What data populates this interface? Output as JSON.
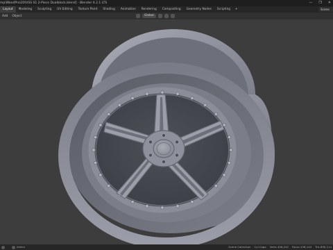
{
  "window": {
    "title": "mp\\WandPro\\20\\VSS S1 2-Piece Dualblock.blend] - Blender 4.2.1 LTS",
    "controls": [
      "—",
      "❐",
      "✕"
    ]
  },
  "workspace_tabs": [
    {
      "label": "Layout",
      "active": true
    },
    {
      "label": "Modeling",
      "active": false
    },
    {
      "label": "Sculpting",
      "active": false
    },
    {
      "label": "UV Editing",
      "active": false
    },
    {
      "label": "Texture Paint",
      "active": false
    },
    {
      "label": "Shading",
      "active": false
    },
    {
      "label": "Animation",
      "active": false
    },
    {
      "label": "Rendering",
      "active": false
    },
    {
      "label": "Compositing",
      "active": false
    },
    {
      "label": "Geometry Nodes",
      "active": false
    },
    {
      "label": "Scripting",
      "active": false
    }
  ],
  "tab_add_label": "+",
  "toolbar": {
    "transform_orientation": "Global",
    "scene_label": "Scene"
  },
  "header": {
    "items": [
      "Add",
      "Object"
    ]
  },
  "statusbar": {
    "left_items": [
      "",
      "Select"
    ],
    "right_items": [
      "Scene Collection",
      "Cyl.Cage",
      "Verts 456,242",
      "Faces 436,144",
      "Tris 890,114"
    ]
  },
  "viewport": {
    "background": "#3d3d3d",
    "wheel_color": "#8a8c98",
    "bolt_count": 6,
    "rivet_count": 28,
    "spoke_count": 5
  }
}
